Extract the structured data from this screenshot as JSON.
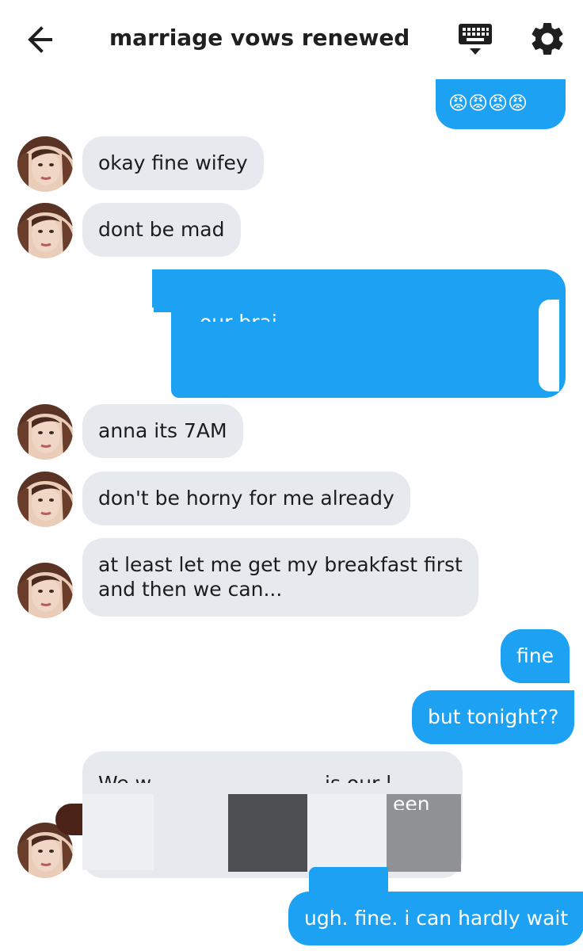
{
  "header": {
    "title": "marriage vows renewed",
    "back_icon": "arrow-left-icon",
    "keyboard_icon": "keyboard-icon",
    "settings_icon": "gear-icon"
  },
  "messages": [
    {
      "side": "out",
      "text": "😡😡😡😡"
    },
    {
      "side": "in",
      "text": "okay fine wifey"
    },
    {
      "side": "in",
      "text": "dont be mad"
    },
    {
      "side": "out",
      "redacted": true,
      "visible_fragment": "our brai"
    },
    {
      "side": "in",
      "text": "anna its 7AM"
    },
    {
      "side": "in",
      "text": "don't be horny for me already"
    },
    {
      "side": "in",
      "line1": "at least let me get my breakfast first",
      "line2": "and then we can..."
    },
    {
      "side": "out",
      "text": "fine"
    },
    {
      "side": "out",
      "text": "but tonight??"
    },
    {
      "side": "in",
      "redacted": true,
      "fragment_a": "We w",
      "fragment_b": "is our l",
      "fragment_c": "een"
    },
    {
      "side": "out",
      "text": "ugh. fine. i can hardly wait"
    }
  ],
  "colors": {
    "outgoing": "#1da1f2",
    "incoming": "#e6eaee",
    "text": "#1c1c1c"
  }
}
